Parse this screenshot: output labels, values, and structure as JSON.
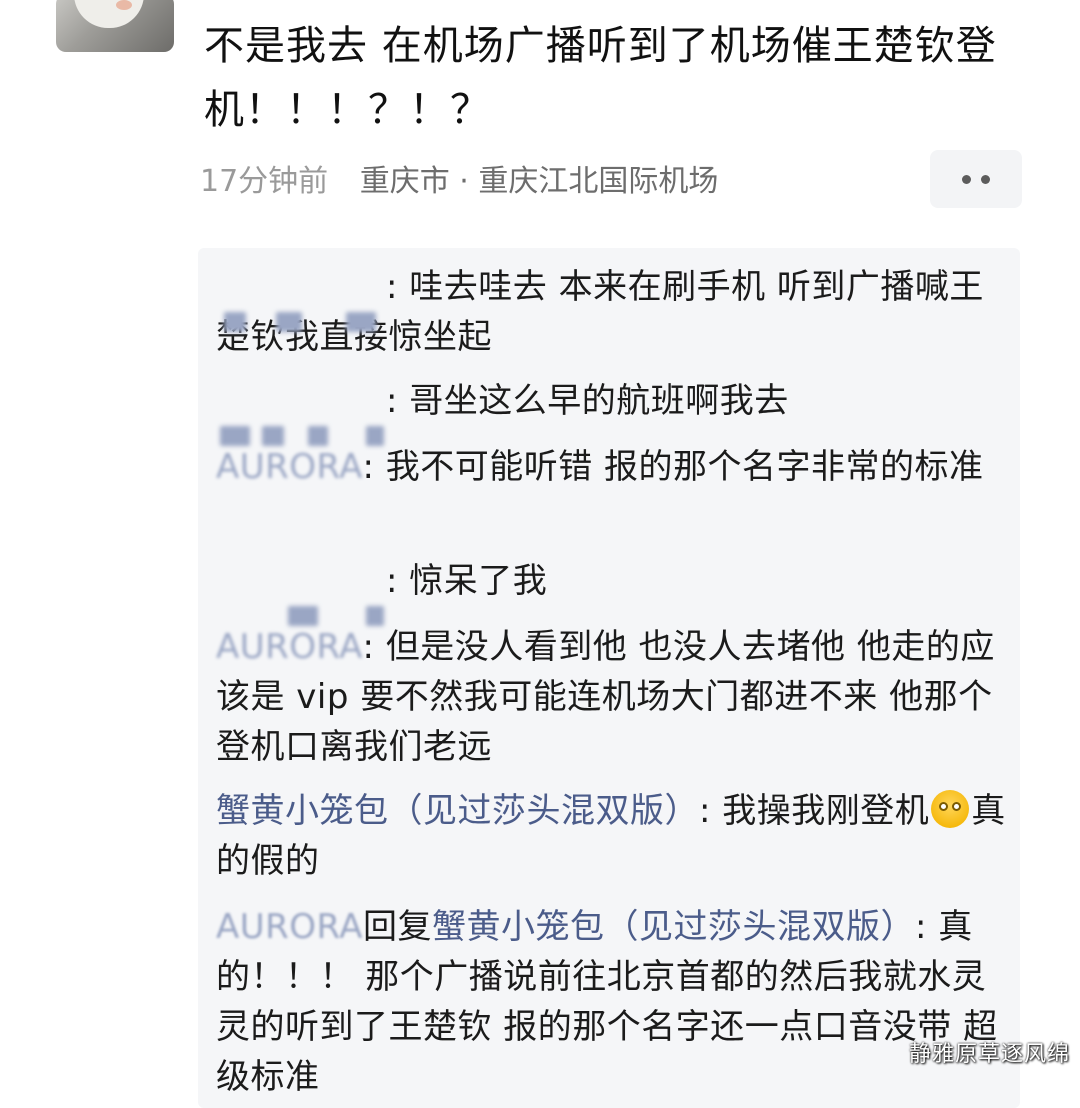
{
  "post": {
    "title": "不是我去 在机场广播听到了机场催王楚钦登机！！！？！？",
    "time": "17分钟前",
    "location": "重庆市 · 重庆江北国际机场"
  },
  "comments": [
    {
      "author": "",
      "text": ": 哇去哇去 本来在刷手机 听到广播喊王楚钦我直接惊坐起"
    },
    {
      "author": "",
      "text": ": 哥坐这么早的航班啊我去"
    },
    {
      "author": "AURORA",
      "text": ": 我不可能听错 报的那个名字非常的标准"
    },
    {
      "author": "",
      "text": ": 惊呆了我"
    },
    {
      "author": "AURORA",
      "text": ": 但是没人看到他 也没人去堵他 他走的应该是 vip 要不然我可能连机场大门都进不来 他那个登机口离我们老远"
    },
    {
      "author": "蟹黄小笼包（见过莎头混双版）",
      "text": ": 我操我刚登机",
      "text_after_emoji": "真的假的"
    },
    {
      "author": "AURORA",
      "reply_word": "回复",
      "reply_to": "蟹黄小笼包（见过莎头混双版）",
      "text": ": 真的！！！ 那个广播说前往北京首都的然后我就水灵灵的听到了王楚钦 报的那个名字还一点口音没带 超级标准"
    }
  ],
  "watermark": "静雅原草逐风绵",
  "icons": {
    "avatar": "user-avatar",
    "more": "more-dots-icon",
    "emoji": "shocked-face-emoji"
  },
  "colors": {
    "author": "#4b5c8a",
    "meta": "#9a9a9a",
    "panel": "#f5f6f8"
  }
}
